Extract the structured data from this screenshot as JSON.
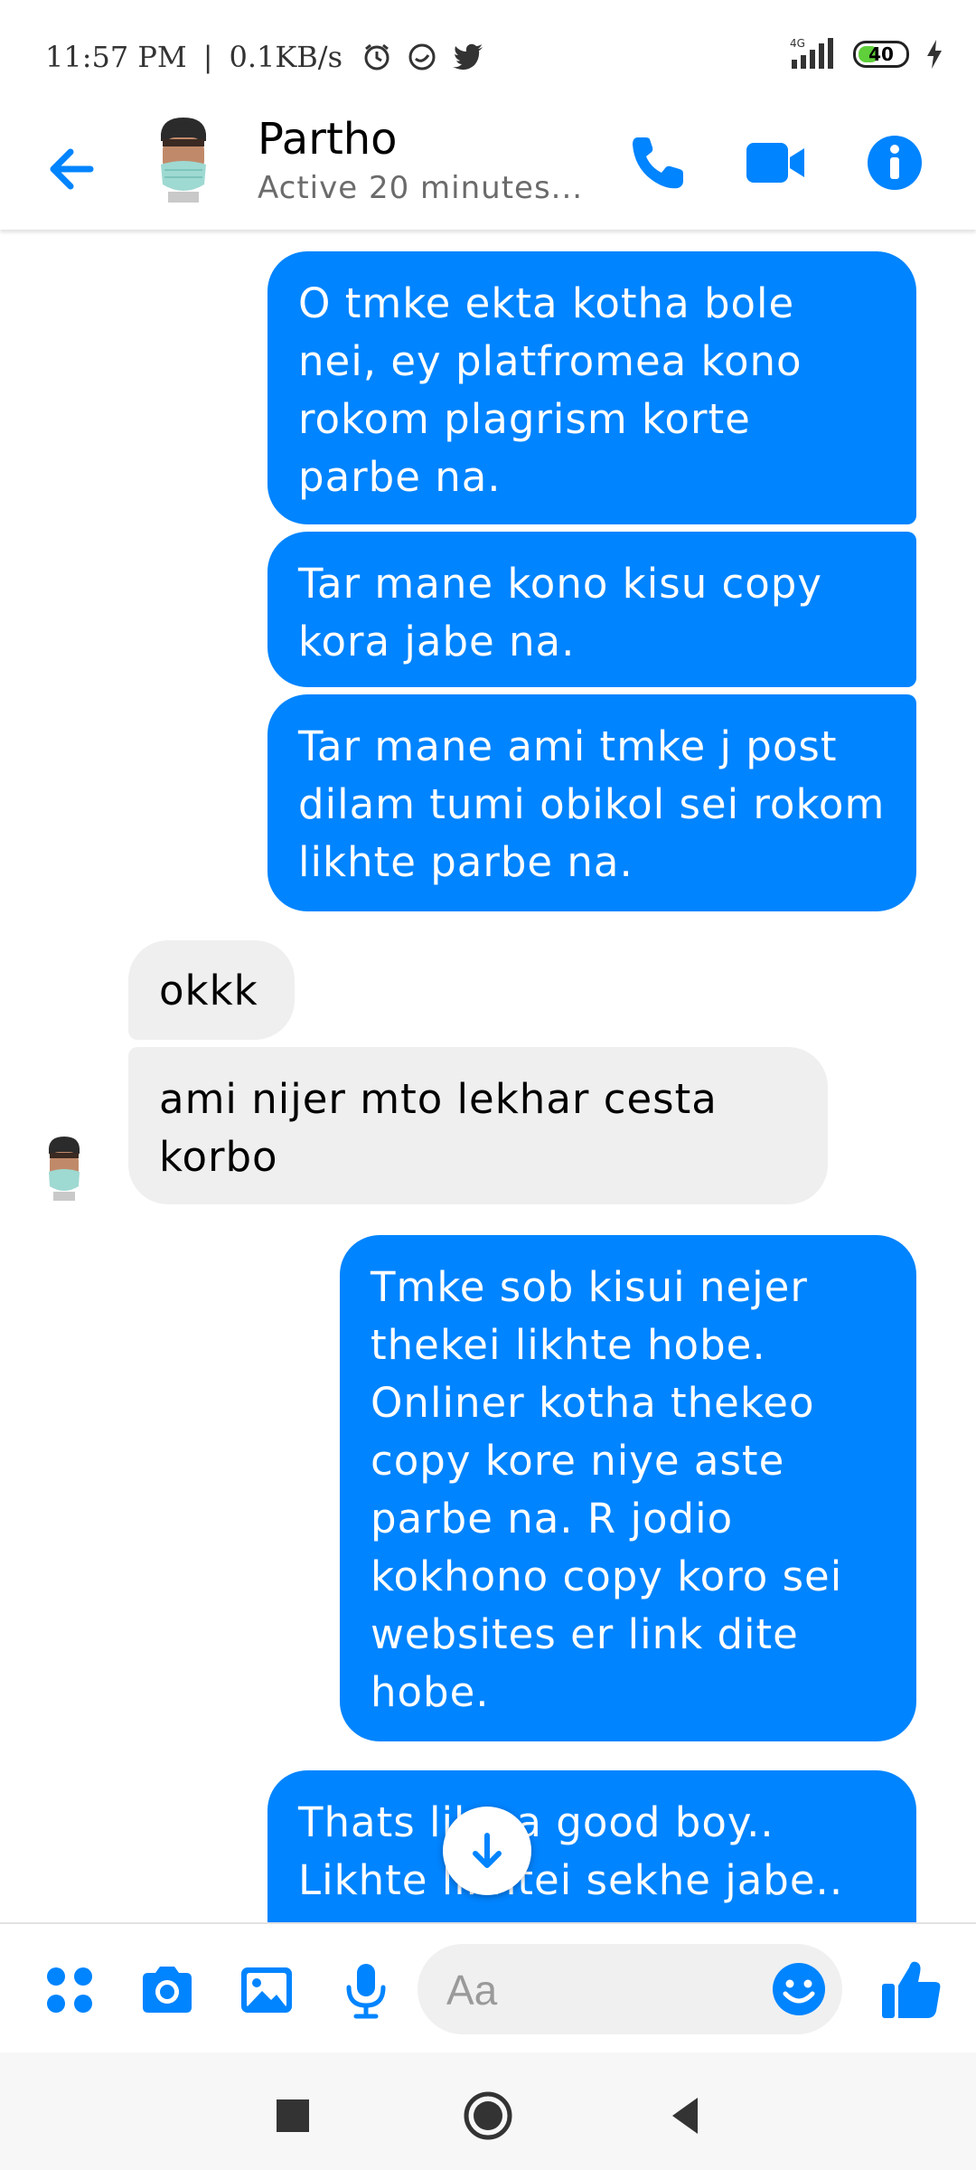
{
  "status_bar": {
    "time": "11:57 PM",
    "speed": "0.1KB/s",
    "network": "4G",
    "battery": "40",
    "icons": [
      "alarm-icon",
      "chat-icon",
      "twitter-icon",
      "signal-icon",
      "charging-icon"
    ]
  },
  "header": {
    "name": "Partho",
    "status": "Active 20 minutes..."
  },
  "messages": [
    {
      "side": "out",
      "text": "O tmke ekta kotha bole nei, ey platfromea kono rokom plagrism korte parbe na."
    },
    {
      "side": "out",
      "text": "Tar mane kono kisu copy kora jabe na."
    },
    {
      "side": "out",
      "text": "Tar mane ami tmke j post dilam tumi obikol sei rokom likhte parbe na."
    },
    {
      "side": "in",
      "text": "okkk"
    },
    {
      "side": "in",
      "text": "ami nijer mto lekhar cesta korbo"
    },
    {
      "side": "out",
      "text": "Tmke sob kisui nejer thekei likhte hobe. Onliner kotha thekeo copy kore niye aste parbe na. R jodio kokhono copy koro sei websites er link dite hobe."
    },
    {
      "side": "out",
      "text": "Thats like a good boy.. Likhte likhtei sekhe jabe.."
    }
  ],
  "composer": {
    "placeholder": "Aa"
  },
  "colors": {
    "accent": "#0084ff",
    "incoming_bubble": "#efefef"
  }
}
